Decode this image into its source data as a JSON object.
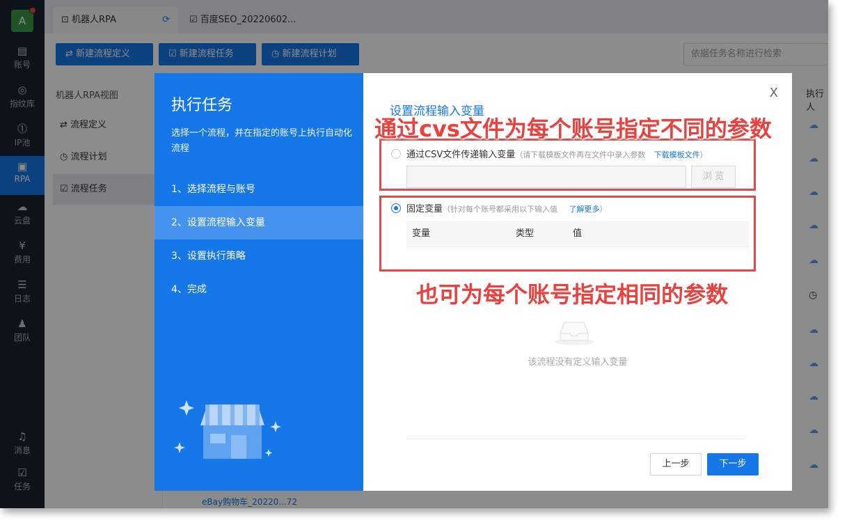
{
  "rail": {
    "avatar_letter": "A",
    "items": [
      {
        "label": "账号",
        "icon": "id-card-icon",
        "glyph": "▤"
      },
      {
        "label": "指纹库",
        "icon": "fingerprint-icon",
        "glyph": "◎"
      },
      {
        "label": "IP池",
        "icon": "ip-icon",
        "glyph": "⓵"
      },
      {
        "label": "RPA",
        "icon": "robot-icon",
        "glyph": "▣"
      },
      {
        "label": "云盘",
        "icon": "cloud-drive-icon",
        "glyph": "☁"
      },
      {
        "label": "费用",
        "icon": "yen-icon",
        "glyph": "¥"
      },
      {
        "label": "日志",
        "icon": "log-icon",
        "glyph": "☰"
      },
      {
        "label": "团队",
        "icon": "team-icon",
        "glyph": "♟"
      },
      {
        "label": "消息",
        "icon": "bell-icon",
        "glyph": "♫"
      },
      {
        "label": "任务",
        "icon": "task-icon",
        "glyph": "☑"
      }
    ]
  },
  "tabs": [
    {
      "label": "机器人RPA"
    },
    {
      "label": "百度SEO_20220602..."
    }
  ],
  "toolbar": {
    "new_definition": "新建流程定义",
    "new_task": "新建流程任务",
    "new_plan": "新建流程计划",
    "search_placeholder": "依据任务名称进行检索"
  },
  "subnav": {
    "title": "机器人RPA视图",
    "items": [
      {
        "label": "流程定义"
      },
      {
        "label": "流程计划"
      },
      {
        "label": "流程任务"
      }
    ]
  },
  "content": {
    "col_header": "执行人",
    "bottom_row": "eBay购物车_20220...72"
  },
  "modal": {
    "title": "执行任务",
    "description": "选择一个流程，并在指定的账号上执行自动化流程",
    "steps": [
      {
        "label": "1、选择流程与账号"
      },
      {
        "label": "2、设置流程输入变量"
      },
      {
        "label": "3、设置执行策略"
      },
      {
        "label": "4、完成"
      }
    ],
    "active_step": 1,
    "right_title": "设置流程输入变量",
    "option_csv": {
      "label": "通过CSV文件传递输入变量",
      "hint": "（请下载模板文件再在文件中录入参数",
      "link": "下载模板文件",
      "hint_end": "）",
      "browse": "浏 览"
    },
    "option_fixed": {
      "label": "固定变量",
      "hint": "（针对每个账号都采用以下输入值",
      "link": "了解更多",
      "hint_end": "）"
    },
    "table_headers": {
      "name": "变量",
      "type": "类型",
      "value": "值"
    },
    "empty_text": "该流程没有定义输入变量",
    "prev": "上一步",
    "next": "下一步",
    "close": "X"
  },
  "annotations": {
    "top": "通过cvs文件为每个账号指定不同的参数",
    "bottom": "也可为每个账号指定相同的参数"
  },
  "colors": {
    "primary": "#1677e8",
    "rail": "#1b2230",
    "annotation_red": "#e8413e"
  }
}
